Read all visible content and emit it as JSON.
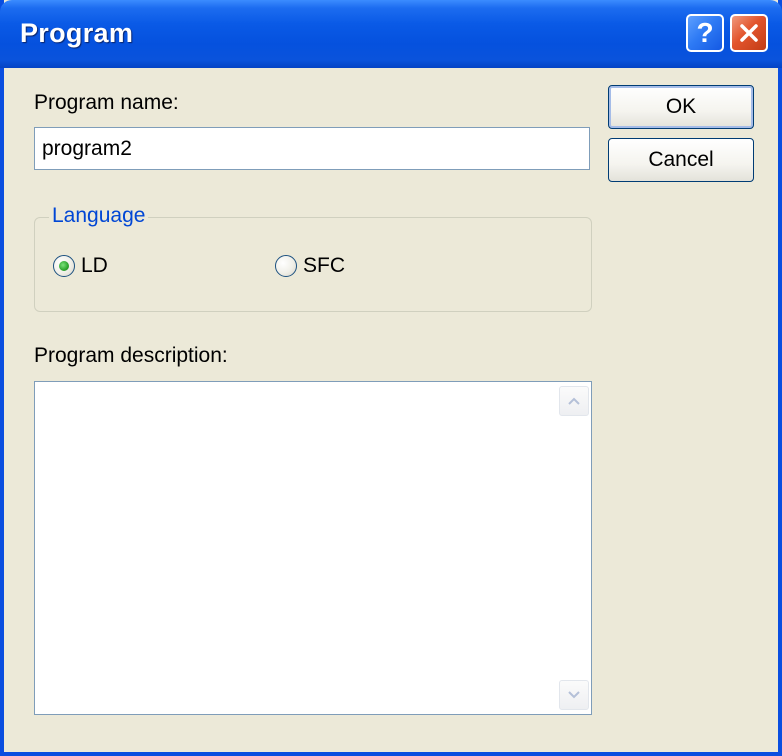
{
  "window": {
    "title": "Program",
    "help_glyph": "?"
  },
  "form": {
    "name_label": "Program name:",
    "name_value": "program2",
    "language": {
      "title": "Language",
      "options": [
        {
          "label": "LD",
          "checked": true
        },
        {
          "label": "SFC",
          "checked": false
        }
      ]
    },
    "description_label": "Program description:",
    "description_value": ""
  },
  "buttons": {
    "ok": "OK",
    "cancel": "Cancel"
  },
  "colors": {
    "titlebar": "#0a5ae6",
    "dialog_bg": "#ece9d8",
    "group_title": "#0046d5",
    "close_button": "#e2542c",
    "radio_dot": "#2ea52e"
  },
  "icons": {
    "help": "question-mark-icon",
    "close": "close-x-icon",
    "scroll_up": "chevron-up-icon",
    "scroll_down": "chevron-down-icon"
  }
}
